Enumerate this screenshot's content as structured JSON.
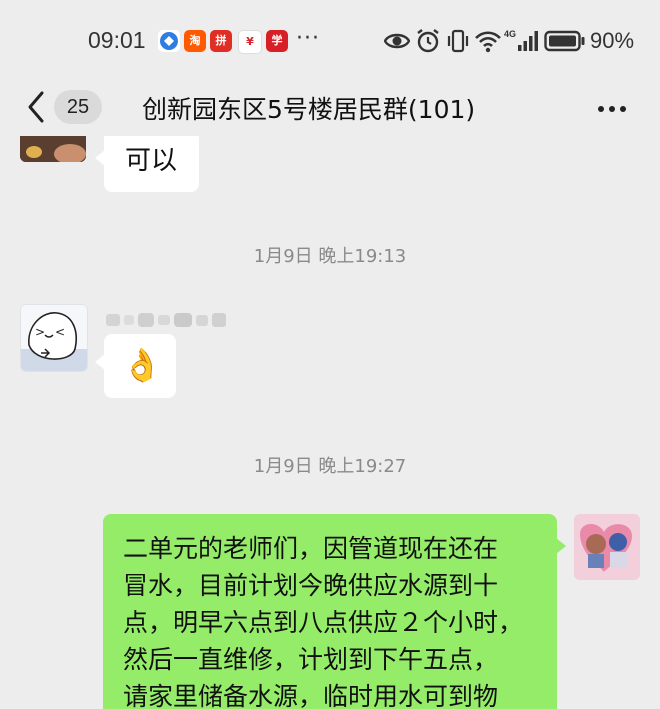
{
  "status_bar": {
    "time": "09:01",
    "more_indicator": "···",
    "battery_percent": "90%",
    "app_icons": [
      {
        "name": "browser-app-icon",
        "color": "#2f7de1"
      },
      {
        "name": "taobao-app-icon",
        "color": "#ff5a00"
      },
      {
        "name": "pinduoduo-app-icon",
        "color": "#e02e24"
      },
      {
        "name": "bank-app-icon",
        "color": "#d9232d"
      },
      {
        "name": "xuexi-app-icon",
        "color": "#d91f26"
      }
    ],
    "status_icons": [
      "eye-icon",
      "alarm-icon",
      "vibrate-icon",
      "wifi-icon",
      "signal-4g-icon",
      "battery-icon"
    ]
  },
  "nav": {
    "unread_count": "25",
    "title": "创新园东区5号楼居民群(101)"
  },
  "messages": [
    {
      "type": "text",
      "side": "left",
      "text": "可以"
    },
    {
      "type": "timestamp",
      "text": "1月9日 晚上19:13"
    },
    {
      "type": "emoji",
      "side": "left",
      "emoji": "👌"
    },
    {
      "type": "timestamp",
      "text": "1月9日 晚上19:27"
    },
    {
      "type": "text",
      "side": "right",
      "lines": [
        "二单元的老师们，因管道现在还在",
        "冒水，目前计划今晚供应水源到十",
        "点，明早六点到八点供应２个小时，",
        "然后一直维修，计划到下午五点，",
        "请家里储备水源，临时用水可到物"
      ]
    }
  ],
  "colors": {
    "background": "#ededed",
    "my_bubble": "#95ec69",
    "other_bubble": "#ffffff",
    "timestamp": "#8a8a8a"
  }
}
